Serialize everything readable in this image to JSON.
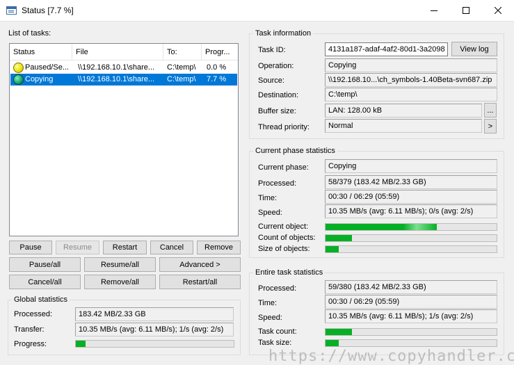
{
  "window": {
    "title": "Status [7.7 %]",
    "controls": {
      "minimize": "minimize-icon",
      "maximize": "maximize-icon",
      "close": "close-icon"
    }
  },
  "tasks": {
    "label": "List of tasks:",
    "columns": [
      "Status",
      "File",
      "To:",
      "Progr..."
    ],
    "rows": [
      {
        "status": "Paused/Se...",
        "file": "\\\\192.168.10.1\\share...",
        "to": "C:\\temp\\",
        "progress": "0.0 %",
        "icon": "paused-status-icon",
        "icon_color": "#e8e000",
        "selected": false
      },
      {
        "status": "Copying",
        "file": "\\\\192.168.10.1\\share...",
        "to": "C:\\temp\\",
        "progress": "7.7 %",
        "icon": "copying-status-icon",
        "icon_color": "#1a9e6a",
        "selected": true
      }
    ]
  },
  "buttons": {
    "pause": "Pause",
    "resume": "Resume",
    "restart": "Restart",
    "cancel": "Cancel",
    "remove": "Remove",
    "pause_all": "Pause/all",
    "resume_all": "Resume/all",
    "advanced": "Advanced >",
    "cancel_all": "Cancel/all",
    "remove_all": "Remove/all",
    "restart_all": "Restart/all",
    "view_log": "View log",
    "buffer_more": "...",
    "priority_more": ">"
  },
  "global_stats": {
    "title": "Global statistics",
    "processed_label": "Processed:",
    "processed_value": "183.42 MB/2.33 GB",
    "transfer_label": "Transfer:",
    "transfer_value": "10.35 MB/s (avg: 6.11 MB/s); 1/s (avg: 2/s)",
    "progress_label": "Progress:",
    "progress": 0.063
  },
  "task_info": {
    "title": "Task information",
    "task_id_label": "Task ID:",
    "task_id": "4131a187-adaf-4af2-80d1-3a2098",
    "operation_label": "Operation:",
    "operation": "Copying",
    "source_label": "Source:",
    "source": "\\\\192.168.10...\\ch_symbols-1.40Beta-svn687.zip",
    "destination_label": "Destination:",
    "destination": "C:\\temp\\",
    "buffer_label": "Buffer size:",
    "buffer": "LAN: 128.00 kB",
    "priority_label": "Thread priority:",
    "priority": "Normal"
  },
  "phase_stats": {
    "title": "Current phase statistics",
    "phase_label": "Current phase:",
    "phase": "Copying",
    "processed_label": "Processed:",
    "processed": "58/379 (183.42 MB/2.33 GB)",
    "time_label": "Time:",
    "time": "00:30 / 06:29 (05:59)",
    "speed_label": "Speed:",
    "speed": "10.35 MB/s (avg: 6.11 MB/s); 0/s (avg: 2/s)",
    "current_object_label": "Current object:",
    "current_object": 0.65,
    "count_label": "Count of objects:",
    "count": 0.153,
    "size_label": "Size of objects:",
    "size": 0.077
  },
  "task_stats": {
    "title": "Entire task statistics",
    "processed_label": "Processed:",
    "processed": "59/380 (183.42 MB/2.33 GB)",
    "time_label": "Time:",
    "time": "00:30 / 06:29 (05:59)",
    "speed_label": "Speed:",
    "speed": "10.35 MB/s (avg: 6.11 MB/s); 1/s (avg: 2/s)",
    "count_label": "Task count:",
    "count": 0.155,
    "size_label": "Task size:",
    "size": 0.077
  },
  "watermark": "https://www.copyhandler.com",
  "colors": {
    "progress_fill": "#06b025",
    "selection": "#0078d7"
  }
}
